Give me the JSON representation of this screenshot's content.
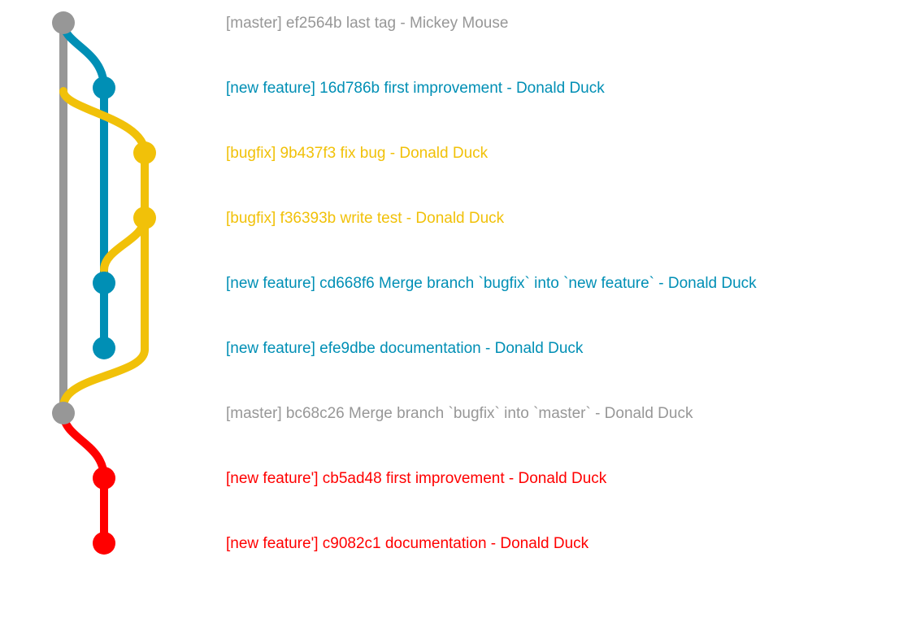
{
  "colors": {
    "master": "#979797",
    "new feature": "#008fb5",
    "bugfix": "#f1c109",
    "new feature'": "#ff0000"
  },
  "commits": [
    {
      "branch": "master",
      "hash": "ef2564b",
      "message": "last tag",
      "author": "Mickey Mouse",
      "label": "[master] ef2564b last tag - Mickey Mouse"
    },
    {
      "branch": "new feature",
      "hash": "16d786b",
      "message": "first improvement",
      "author": "Donald Duck",
      "label": "[new feature] 16d786b first improvement - Donald Duck"
    },
    {
      "branch": "bugfix",
      "hash": "9b437f3",
      "message": "fix bug",
      "author": "Donald Duck",
      "label": "[bugfix] 9b437f3 fix bug - Donald Duck"
    },
    {
      "branch": "bugfix",
      "hash": "f36393b",
      "message": "write test",
      "author": "Donald Duck",
      "label": "[bugfix] f36393b write test - Donald Duck"
    },
    {
      "branch": "new feature",
      "hash": "cd668f6",
      "message": "Merge branch `bugfix` into `new feature`",
      "author": "Donald Duck",
      "label": "[new feature] cd668f6 Merge branch `bugfix` into `new feature` - Donald Duck"
    },
    {
      "branch": "new feature",
      "hash": "efe9dbe",
      "message": "documentation",
      "author": "Donald Duck",
      "label": "[new feature] efe9dbe documentation - Donald Duck"
    },
    {
      "branch": "master",
      "hash": "bc68c26",
      "message": "Merge branch `bugfix` into `master`",
      "author": "Donald Duck",
      "label": "[master] bc68c26 Merge branch `bugfix` into `master` - Donald Duck"
    },
    {
      "branch": "new feature'",
      "hash": "cb5ad48",
      "message": "first improvement",
      "author": "Donald Duck",
      "label": "[new feature'] cb5ad48 first improvement - Donald Duck"
    },
    {
      "branch": "new feature'",
      "hash": "c9082c1",
      "message": "documentation",
      "author": "Donald Duck",
      "label": "[new feature'] c9082c1 documentation - Donald Duck"
    }
  ]
}
